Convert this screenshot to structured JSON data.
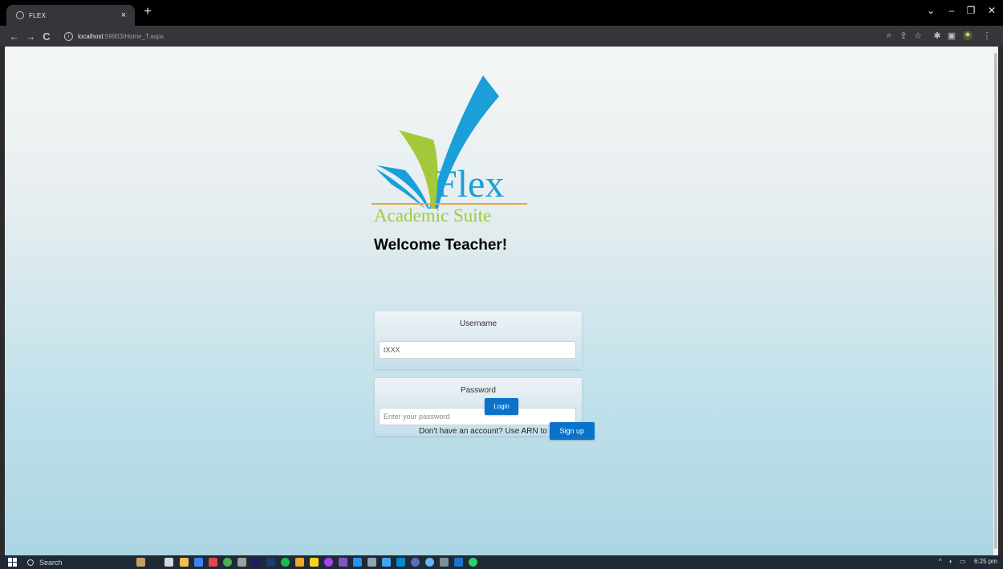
{
  "browser": {
    "tab_title": "FLEX",
    "tab_close": "×",
    "new_tab": "+",
    "url_host": "localhost",
    "url_path": ":59903/Home_T.aspx",
    "window_controls": [
      "⌄",
      "–",
      "❐",
      "✕"
    ],
    "toolbar_icons": [
      "zoom-icon",
      "share-icon",
      "star-icon",
      "extensions-icon",
      "sidepanel-icon",
      "profile-icon",
      "menu-icon"
    ]
  },
  "page": {
    "logo": {
      "title": "Flex",
      "subtitle": "Academic Suite",
      "colors": {
        "blue": "#1a9fd8",
        "green": "#9ccc3c",
        "line": "#e3a638"
      }
    },
    "welcome": "Welcome Teacher!",
    "username": {
      "label": "Username",
      "value": "tXXX",
      "placeholder": ""
    },
    "password": {
      "label": "Password",
      "value": "",
      "placeholder": "Enter your password"
    },
    "login_label": "Login",
    "signup_prompt": "Don't have an account? Use ARN to",
    "signup_label": "Sign up",
    "accent_color": "#0a72c9"
  },
  "taskbar": {
    "search_label": "Search",
    "clock": "6:25 pm",
    "tray_arrow": "^",
    "apps": [
      "file-explorer",
      "store",
      "chrome",
      "premiere",
      "photoshop",
      "spotify",
      "sublime",
      "vs",
      "vscode",
      "teams",
      "whatsapp"
    ]
  }
}
